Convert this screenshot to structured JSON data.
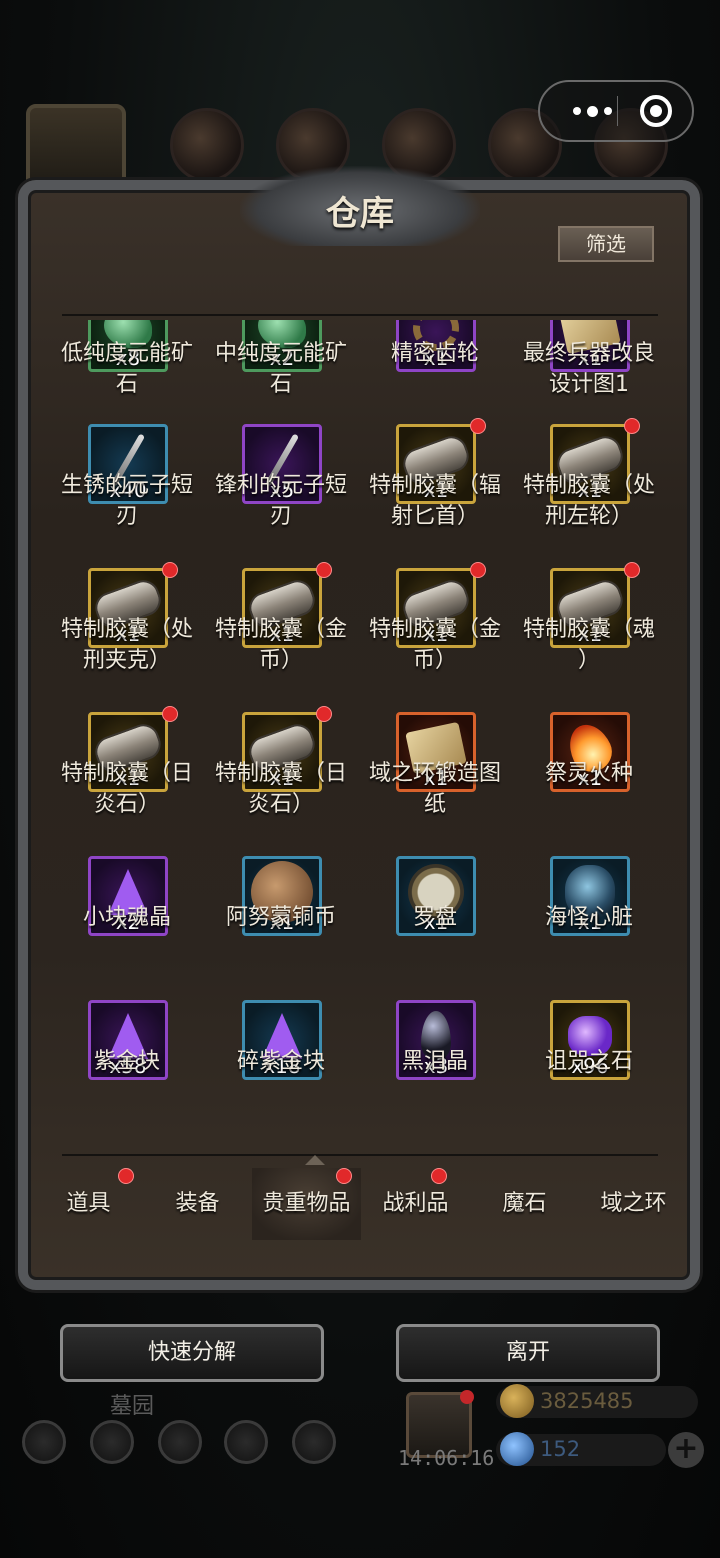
{
  "panel": {
    "title": "仓库",
    "filter_label": "筛选"
  },
  "colors": {
    "badge_red": "#e1292a",
    "text_main": "#efe9dc",
    "panel_bg": "#2c251f"
  },
  "items": [
    {
      "name": "低纯度元能矿\n石",
      "qty": "x8",
      "rarity": "green",
      "icon": "ore-icon",
      "badge": false
    },
    {
      "name": "中纯度元能矿\n石",
      "qty": "x2",
      "rarity": "green",
      "icon": "ore-icon",
      "badge": false
    },
    {
      "name": "精密齿轮",
      "qty": "x1",
      "rarity": "purple",
      "icon": "gear-icon",
      "badge": false
    },
    {
      "name": "最终兵器改良\n设计图1",
      "qty": "x1",
      "rarity": "purple",
      "icon": "scroll-icon",
      "badge": false
    },
    {
      "name": "生锈的元子短\n刃",
      "qty": "x40",
      "rarity": "blue",
      "icon": "blade-icon",
      "badge": false
    },
    {
      "name": "锋利的元子短\n刃",
      "qty": "x5",
      "rarity": "purple",
      "icon": "blade-icon",
      "badge": false
    },
    {
      "name": "特制胶囊（辐\n射匕首）",
      "qty": "x1",
      "rarity": "gold",
      "icon": "capsule-icon",
      "badge": true
    },
    {
      "name": "特制胶囊（处\n刑左轮）",
      "qty": "x1",
      "rarity": "gold",
      "icon": "capsule-icon",
      "badge": true
    },
    {
      "name": "特制胶囊（处\n刑夹克）",
      "qty": "x1",
      "rarity": "gold",
      "icon": "capsule-icon",
      "badge": true
    },
    {
      "name": "特制胶囊（金\n币）",
      "qty": "x1",
      "rarity": "gold",
      "icon": "capsule-icon",
      "badge": true
    },
    {
      "name": "特制胶囊（金\n币）",
      "qty": "x1",
      "rarity": "gold",
      "icon": "capsule-icon",
      "badge": true
    },
    {
      "name": "特制胶囊（魂\n）",
      "qty": "x1",
      "rarity": "gold",
      "icon": "capsule-icon",
      "badge": true
    },
    {
      "name": "特制胶囊（日\n炎石）",
      "qty": "x1",
      "rarity": "gold",
      "icon": "capsule-icon",
      "badge": true
    },
    {
      "name": "特制胶囊（日\n炎石）",
      "qty": "x1",
      "rarity": "gold",
      "icon": "capsule-icon",
      "badge": true
    },
    {
      "name": "域之环锻造图\n纸",
      "qty": "x1",
      "rarity": "red",
      "icon": "scroll-icon",
      "badge": false
    },
    {
      "name": "祭灵火种",
      "qty": "x1",
      "rarity": "red",
      "icon": "flame-icon",
      "badge": false
    },
    {
      "name": "小块魂晶",
      "qty": "x2",
      "rarity": "purple",
      "icon": "crystal-icon",
      "badge": false
    },
    {
      "name": "阿努蒙铜币",
      "qty": "x1",
      "rarity": "blue",
      "icon": "coin-icon",
      "badge": false
    },
    {
      "name": "罗盘",
      "qty": "x1",
      "rarity": "blue",
      "icon": "compass-icon",
      "badge": false
    },
    {
      "name": "海怪心脏",
      "qty": "x1",
      "rarity": "blue",
      "icon": "heart-icon",
      "badge": false
    },
    {
      "name": "紫金块",
      "qty": "x58",
      "rarity": "purple",
      "icon": "crystal-icon",
      "badge": false
    },
    {
      "name": "碎紫金块",
      "qty": "x18",
      "rarity": "blue",
      "icon": "crystal-icon",
      "badge": false
    },
    {
      "name": "黑泪晶",
      "qty": "x3",
      "rarity": "purple",
      "icon": "tear-icon",
      "badge": false
    },
    {
      "name": "诅咒之石",
      "qty": "x96",
      "rarity": "gold",
      "icon": "curse-stone-icon",
      "badge": false
    }
  ],
  "tabs": [
    {
      "label": "道具",
      "badge": true
    },
    {
      "label": "装备",
      "badge": false
    },
    {
      "label": "贵重物品",
      "badge": true
    },
    {
      "label": "战利品",
      "badge": true
    },
    {
      "label": "魔石",
      "badge": false
    },
    {
      "label": "域之环",
      "badge": false
    }
  ],
  "active_tab": 2,
  "actions": {
    "decompose_label": "快速分解",
    "leave_label": "离开"
  },
  "hud": {
    "area_name": "墓园",
    "time": "14:06:16",
    "gold": "3825485",
    "gems": "152"
  }
}
